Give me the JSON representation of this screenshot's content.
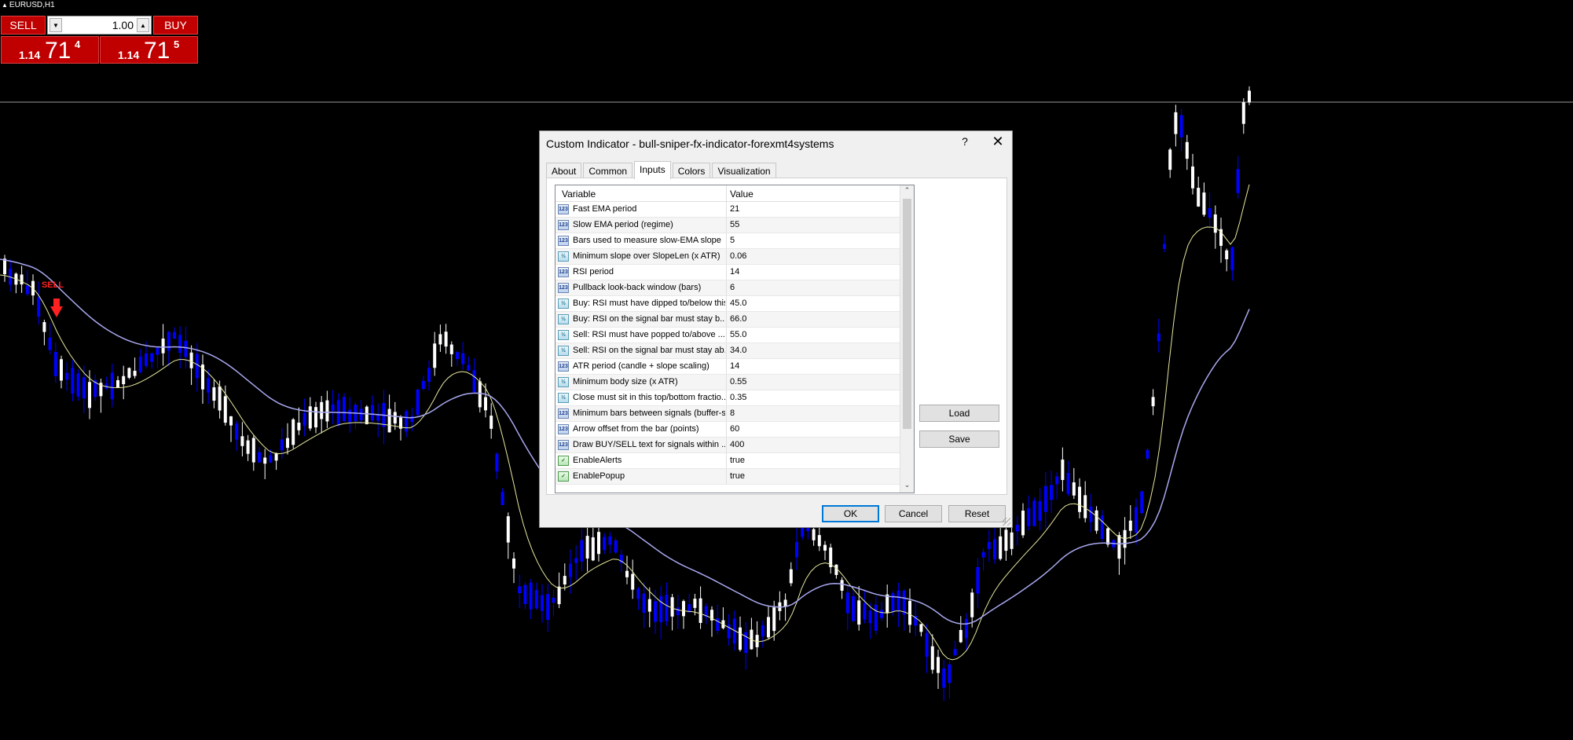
{
  "symbol": "EURUSD,H1",
  "trade_panel": {
    "sell_label": "SELL",
    "buy_label": "BUY",
    "lot_value": "1.00",
    "bid": {
      "small": "1.14",
      "big": "71",
      "sup": "4"
    },
    "ask": {
      "small": "1.14",
      "big": "71",
      "sup": "5"
    }
  },
  "chart_marker": {
    "text": "SELL"
  },
  "colors": {
    "background": "#000000",
    "bull_candle": "#ffffff",
    "bear_candle": "#0000ff",
    "fast_ema": "#e8e8a0",
    "slow_ema": "#a8a8f0",
    "sell_marker": "#ff2020",
    "trade_red": "#c00000"
  },
  "dialog": {
    "title": "Custom Indicator - bull-sniper-fx-indicator-forexmt4systems",
    "help": "?",
    "close": "✕",
    "tabs": [
      "About",
      "Common",
      "Inputs",
      "Colors",
      "Visualization"
    ],
    "active_tab": "Inputs",
    "columns": {
      "variable": "Variable",
      "value": "Value"
    },
    "rows": [
      {
        "icon": "int",
        "name": "Fast EMA period",
        "value": "21"
      },
      {
        "icon": "int",
        "name": "Slow EMA period (regime)",
        "value": "55"
      },
      {
        "icon": "int",
        "name": "Bars used to measure slow-EMA slope",
        "value": "5"
      },
      {
        "icon": "double",
        "name": "Minimum slope over SlopeLen (x ATR)",
        "value": "0.06"
      },
      {
        "icon": "int",
        "name": "RSI period",
        "value": "14"
      },
      {
        "icon": "int",
        "name": "Pullback look-back window (bars)",
        "value": "6"
      },
      {
        "icon": "double",
        "name": "Buy: RSI must have dipped to/below this",
        "value": "45.0"
      },
      {
        "icon": "double",
        "name": "Buy: RSI on the signal bar must stay b...",
        "value": "66.0"
      },
      {
        "icon": "double",
        "name": "Sell: RSI must have popped to/above ...",
        "value": "55.0"
      },
      {
        "icon": "double",
        "name": "Sell: RSI on the signal bar must stay ab...",
        "value": "34.0"
      },
      {
        "icon": "int",
        "name": "ATR period (candle + slope scaling)",
        "value": "14"
      },
      {
        "icon": "double",
        "name": "Minimum body size (x ATR)",
        "value": "0.55"
      },
      {
        "icon": "double",
        "name": "Close must sit in this top/bottom fractio...",
        "value": "0.35"
      },
      {
        "icon": "int",
        "name": "Minimum bars between signals (buffer-s...",
        "value": "8"
      },
      {
        "icon": "int",
        "name": "Arrow offset from the bar (points)",
        "value": "60"
      },
      {
        "icon": "int",
        "name": "Draw BUY/SELL text for signals within ...",
        "value": "400"
      },
      {
        "icon": "bool",
        "name": "EnableAlerts",
        "value": "true"
      },
      {
        "icon": "bool",
        "name": "EnablePopup",
        "value": "true"
      }
    ],
    "buttons": {
      "load": "Load",
      "save": "Save",
      "ok": "OK",
      "cancel": "Cancel",
      "reset": "Reset"
    }
  }
}
